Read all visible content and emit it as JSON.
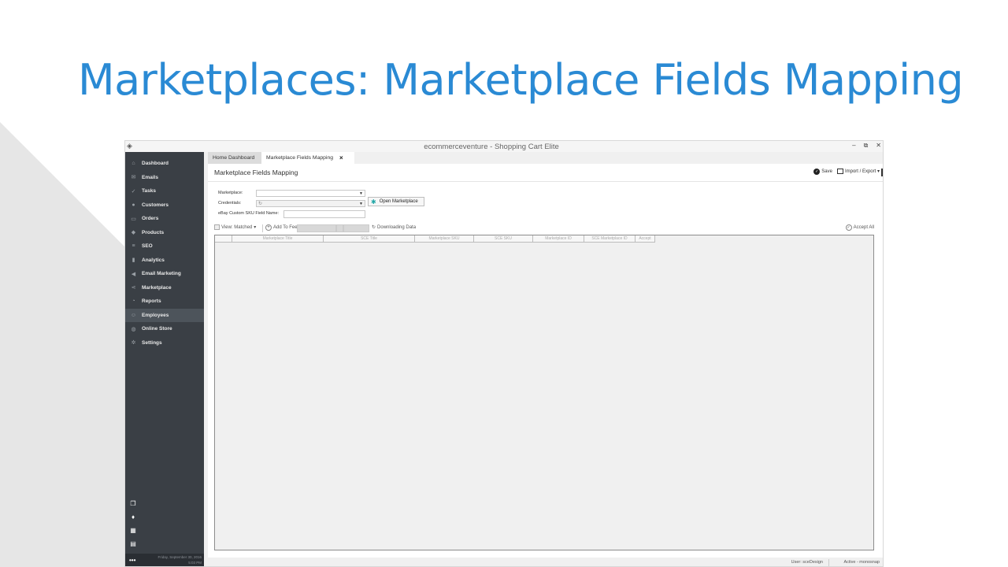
{
  "slide": {
    "title": "Marketplaces: Marketplace Fields Mapping"
  },
  "window": {
    "title": "ecommerceventure - Shopping Cart Elite",
    "controls": [
      "–",
      "⧉",
      "✕"
    ]
  },
  "sidebar": {
    "items": [
      {
        "label": "Dashboard",
        "icon": "home-icon"
      },
      {
        "label": "Emails",
        "icon": "envelope-icon"
      },
      {
        "label": "Tasks",
        "icon": "tasks-icon"
      },
      {
        "label": "Customers",
        "icon": "person-icon"
      },
      {
        "label": "Orders",
        "icon": "cart-icon"
      },
      {
        "label": "Products",
        "icon": "tag-icon"
      },
      {
        "label": "SEO",
        "icon": "seo-icon"
      },
      {
        "label": "Analytics",
        "icon": "bar-chart-icon"
      },
      {
        "label": "Email Marketing",
        "icon": "megaphone-icon"
      },
      {
        "label": "Marketplace",
        "icon": "share-icon"
      },
      {
        "label": "Reports",
        "icon": "pie-chart-icon"
      },
      {
        "label": "Employees",
        "icon": "people-icon",
        "active": true
      },
      {
        "label": "Online Store",
        "icon": "globe-icon"
      },
      {
        "label": "Settings",
        "icon": "gear-icon"
      }
    ],
    "footer": {
      "more": "•••",
      "date": "Friday, September 30, 2016",
      "time": "5:03 PM"
    }
  },
  "tabs": {
    "home": "Home Dashboard",
    "current": "Marketplace Fields Mapping",
    "close": "×"
  },
  "panel": {
    "title": "Marketplace Fields Mapping",
    "save_label": "Save",
    "import_export_label": "Import / Export",
    "form": {
      "marketplace_label": "Marketplace:",
      "credentials_label": "Credentials:",
      "sku_field_label": "eBay Custom SKU Field Name:",
      "open_marketplace_label": "Open Marketplace"
    },
    "toolbar": {
      "view_label": "View: Matched",
      "add_label": "Add To Fee",
      "downloading_label": "Downloading Data",
      "accept_all_label": "Accept All"
    },
    "grid": {
      "columns": [
        "",
        "Marketplace Title",
        "SCE Title",
        "Marketplace SKU",
        "SCE SKU",
        "Marketplace ID",
        "SCE Marketplace ID",
        "Accept"
      ]
    }
  },
  "status": {
    "user": "User: sceDesign",
    "active": "Active - monosnap"
  }
}
